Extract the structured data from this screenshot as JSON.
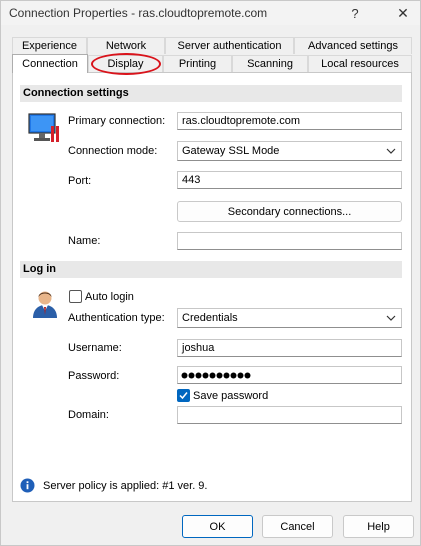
{
  "window": {
    "title": "Connection Properties - ras.cloudtopremote.com",
    "help_glyph": "?",
    "close_glyph": "✕"
  },
  "tabs": {
    "row1": [
      {
        "label": "Experience"
      },
      {
        "label": "Network"
      },
      {
        "label": "Server authentication"
      },
      {
        "label": "Advanced settings"
      }
    ],
    "row2": [
      {
        "label": "Connection",
        "active": true
      },
      {
        "label": "Display",
        "highlighted": true
      },
      {
        "label": "Printing"
      },
      {
        "label": "Scanning"
      },
      {
        "label": "Local resources"
      }
    ]
  },
  "connection_settings": {
    "header": "Connection settings",
    "primary_label": "Primary connection:",
    "primary_value": "ras.cloudtopremote.com",
    "mode_label": "Connection mode:",
    "mode_value": "Gateway SSL Mode",
    "port_label": "Port:",
    "port_value": "443",
    "secondary_button": "Secondary connections...",
    "name_label": "Name:",
    "name_value": ""
  },
  "login": {
    "header": "Log in",
    "auto_login_label": "Auto login",
    "auto_login_checked": false,
    "auth_type_label": "Authentication type:",
    "auth_type_value": "Credentials",
    "username_label": "Username:",
    "username_value": "joshua",
    "password_label": "Password:",
    "password_length": 10,
    "save_password_label": "Save password",
    "save_password_checked": true,
    "domain_label": "Domain:",
    "domain_value": ""
  },
  "status": {
    "policy_text": "Server policy is applied: #1 ver. 9."
  },
  "footer": {
    "ok": "OK",
    "cancel": "Cancel",
    "help": "Help"
  },
  "colors": {
    "accent": "#0067c0",
    "highlight_ring": "#d9131b",
    "section_bg": "#e8e8e8"
  },
  "icons": {
    "connection": "monitor-icon",
    "login": "user-icon",
    "info": "info-icon",
    "dropdown": "chevron-down-icon"
  }
}
